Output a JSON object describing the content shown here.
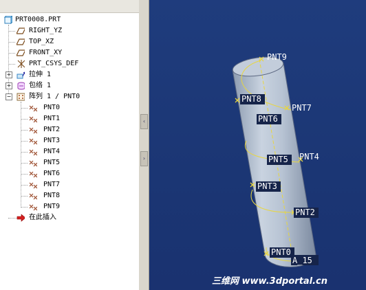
{
  "model_tree": {
    "root": "PRT0008.PRT",
    "datums": [
      "RIGHT_YZ",
      "TOP_XZ",
      "FRONT_XY",
      "PRT_CSYS_DEF"
    ],
    "features": [
      {
        "label": "拉伸 1",
        "expander": "+"
      },
      {
        "label": "包络 1",
        "expander": "+"
      },
      {
        "label": "阵列 1 / PNT0",
        "expander": "−"
      }
    ],
    "pattern_points": [
      "PNT0",
      "PNT1",
      "PNT2",
      "PNT3",
      "PNT4",
      "PNT5",
      "PNT6",
      "PNT7",
      "PNT8",
      "PNT9"
    ],
    "insert_here": "在此插入"
  },
  "splitter": {
    "collapse_arrow": "‹",
    "expand_arrow": "›"
  },
  "viewport": {
    "point_labels": [
      "PNT9",
      "PNT8",
      "PNT7",
      "PNT6",
      "PNT5",
      "PNT4",
      "PNT3",
      "PNT2",
      "PNT0"
    ],
    "axis_label": "A_15",
    "background_color": "#1f3c7d",
    "cylinder_color": "#b7c3d3",
    "curve_color": "#e8d640"
  },
  "watermark": "三维网 www.3dportal.cn"
}
